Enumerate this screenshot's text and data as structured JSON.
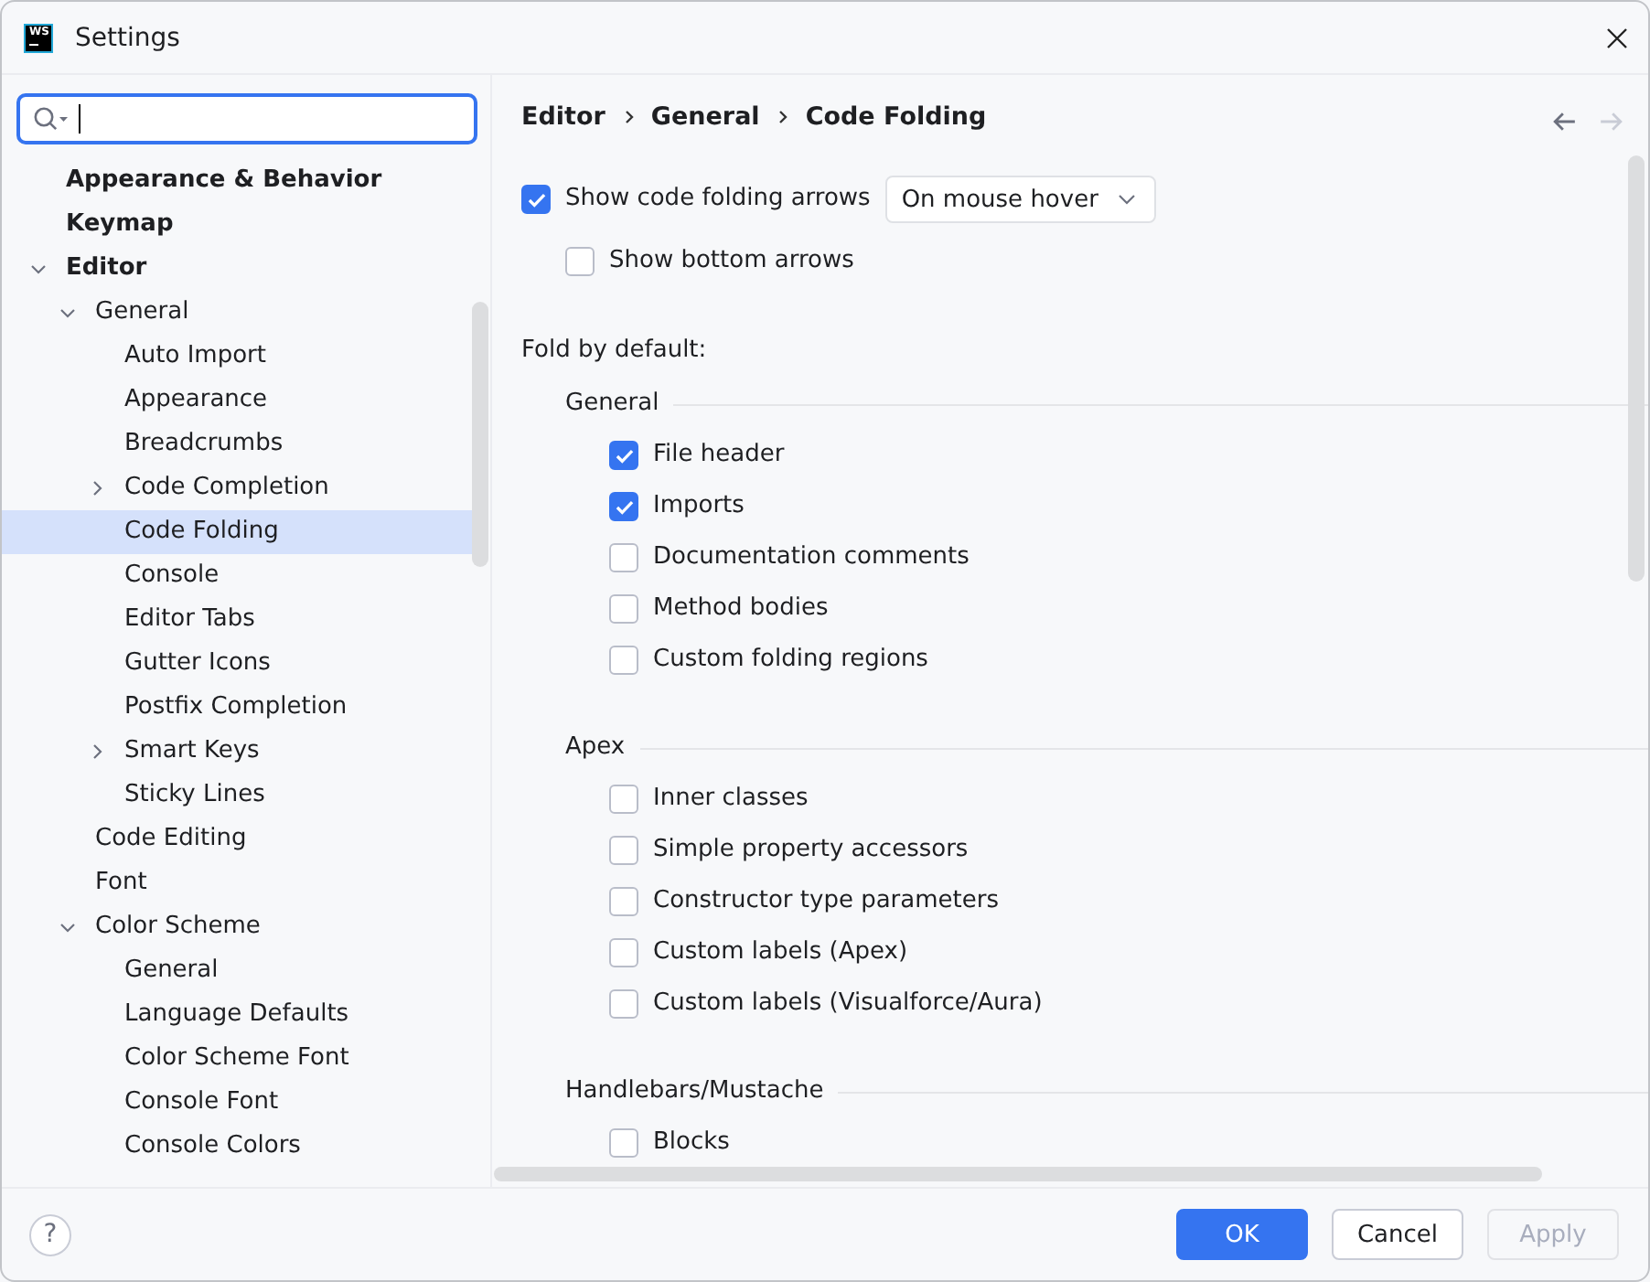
{
  "window": {
    "title": "Settings",
    "logo_text": "WS"
  },
  "search": {
    "focused": true
  },
  "tree": [
    {
      "label": "Appearance & Behavior",
      "selected": false
    },
    {
      "label": "Keymap",
      "selected": false
    },
    {
      "label": "Editor",
      "selected": false,
      "expanded": true,
      "children": [
        {
          "label": "General",
          "selected": false,
          "expanded": true,
          "children": [
            {
              "label": "Auto Import",
              "selected": false
            },
            {
              "label": "Appearance",
              "selected": false
            },
            {
              "label": "Breadcrumbs",
              "selected": false
            },
            {
              "label": "Code Completion",
              "selected": false,
              "expanded": false
            },
            {
              "label": "Code Folding",
              "selected": true
            },
            {
              "label": "Console",
              "selected": false
            },
            {
              "label": "Editor Tabs",
              "selected": false
            },
            {
              "label": "Gutter Icons",
              "selected": false
            },
            {
              "label": "Postfix Completion",
              "selected": false
            },
            {
              "label": "Smart Keys",
              "selected": false,
              "expanded": false
            },
            {
              "label": "Sticky Lines",
              "selected": false
            }
          ]
        },
        {
          "label": "Code Editing",
          "selected": false
        },
        {
          "label": "Font",
          "selected": false
        },
        {
          "label": "Color Scheme",
          "selected": false,
          "expanded": true,
          "children": [
            {
              "label": "General",
              "selected": false
            },
            {
              "label": "Language Defaults",
              "selected": false
            },
            {
              "label": "Color Scheme Font",
              "selected": false
            },
            {
              "label": "Console Font",
              "selected": false
            },
            {
              "label": "Console Colors",
              "selected": false
            }
          ]
        }
      ]
    }
  ],
  "breadcrumbs": [
    "Editor",
    "General",
    "Code Folding"
  ],
  "history_nav": [
    {
      "kind": "back",
      "disabled": false
    },
    {
      "kind": "forward",
      "disabled": true
    }
  ],
  "options": [
    {
      "label": "Show code folding arrows",
      "checked": true,
      "dropdown": {
        "value": "On mouse hover"
      },
      "children": [
        {
          "label": "Show bottom arrows",
          "checked": false
        }
      ]
    }
  ],
  "fold_by_default": {
    "label": "Fold by default:",
    "groups": [
      {
        "title": "General",
        "items": [
          {
            "label": "File header",
            "checked": true
          },
          {
            "label": "Imports",
            "checked": true
          },
          {
            "label": "Documentation comments",
            "checked": false
          },
          {
            "label": "Method bodies",
            "checked": false
          },
          {
            "label": "Custom folding regions",
            "checked": false
          }
        ]
      },
      {
        "title": "Apex",
        "items": [
          {
            "label": "Inner classes",
            "checked": false
          },
          {
            "label": "Simple property accessors",
            "checked": false
          },
          {
            "label": "Constructor type parameters",
            "checked": false
          },
          {
            "label": "Custom labels (Apex)",
            "checked": false
          },
          {
            "label": "Custom labels (Visualforce/Aura)",
            "checked": false
          }
        ]
      },
      {
        "title": "Handlebars/Mustache",
        "items": [
          {
            "label": "Blocks",
            "checked": false
          }
        ]
      }
    ]
  },
  "help_button": {
    "label": "?"
  },
  "buttons": [
    {
      "label": "OK",
      "kind": "primary",
      "disabled": false
    },
    {
      "label": "Cancel",
      "kind": "secondary",
      "disabled": false
    },
    {
      "label": "Apply",
      "kind": "secondary",
      "disabled": true
    }
  ]
}
